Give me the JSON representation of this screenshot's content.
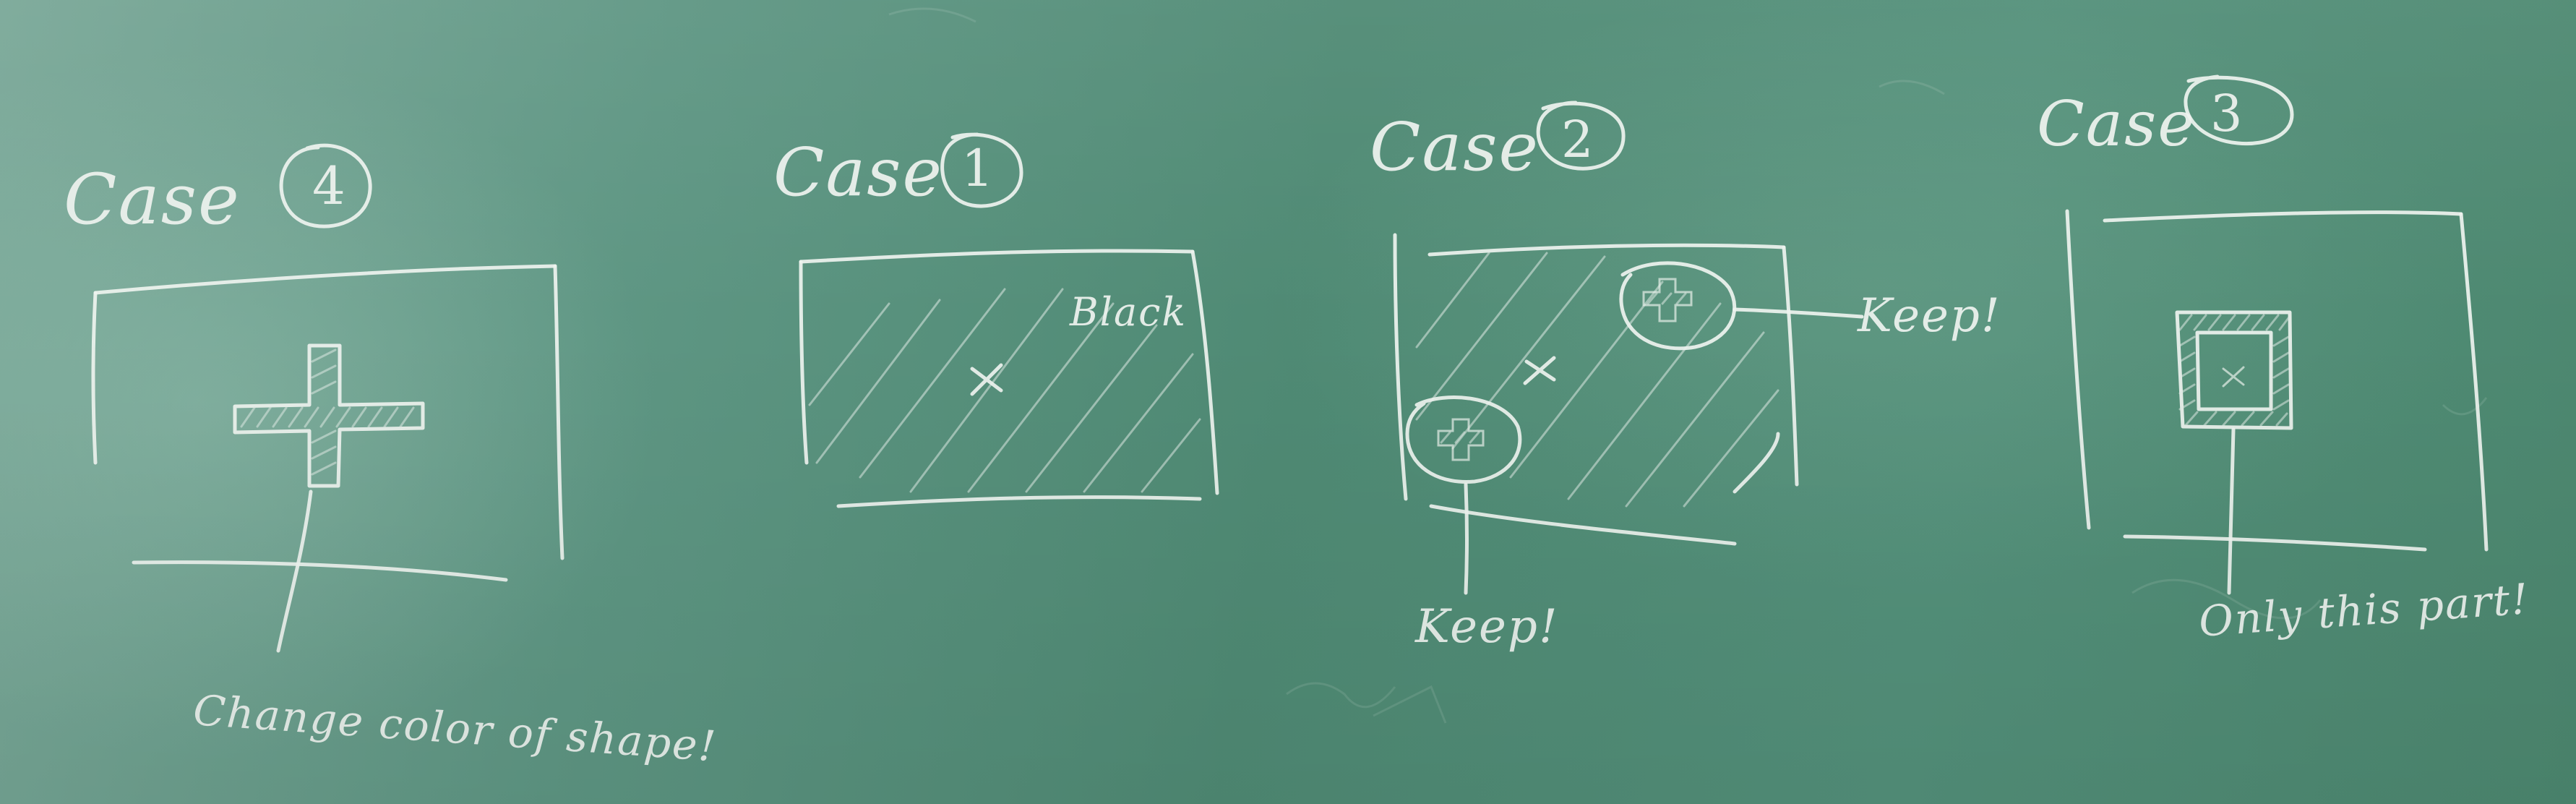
{
  "board": {
    "background_color": "#548f79",
    "chalk_color": "#eef3ef"
  },
  "cases": [
    {
      "id": "case-4",
      "title": "Case",
      "number": "4",
      "notes": [
        "Change color of shape!"
      ]
    },
    {
      "id": "case-1",
      "title": "Case",
      "number": "1",
      "notes": [
        "Black"
      ]
    },
    {
      "id": "case-2",
      "title": "Case",
      "number": "2",
      "notes": [
        "Keep!",
        "Keep!"
      ]
    },
    {
      "id": "case-3",
      "title": "Case",
      "number": "3",
      "notes": [
        "Only this part!"
      ]
    }
  ]
}
